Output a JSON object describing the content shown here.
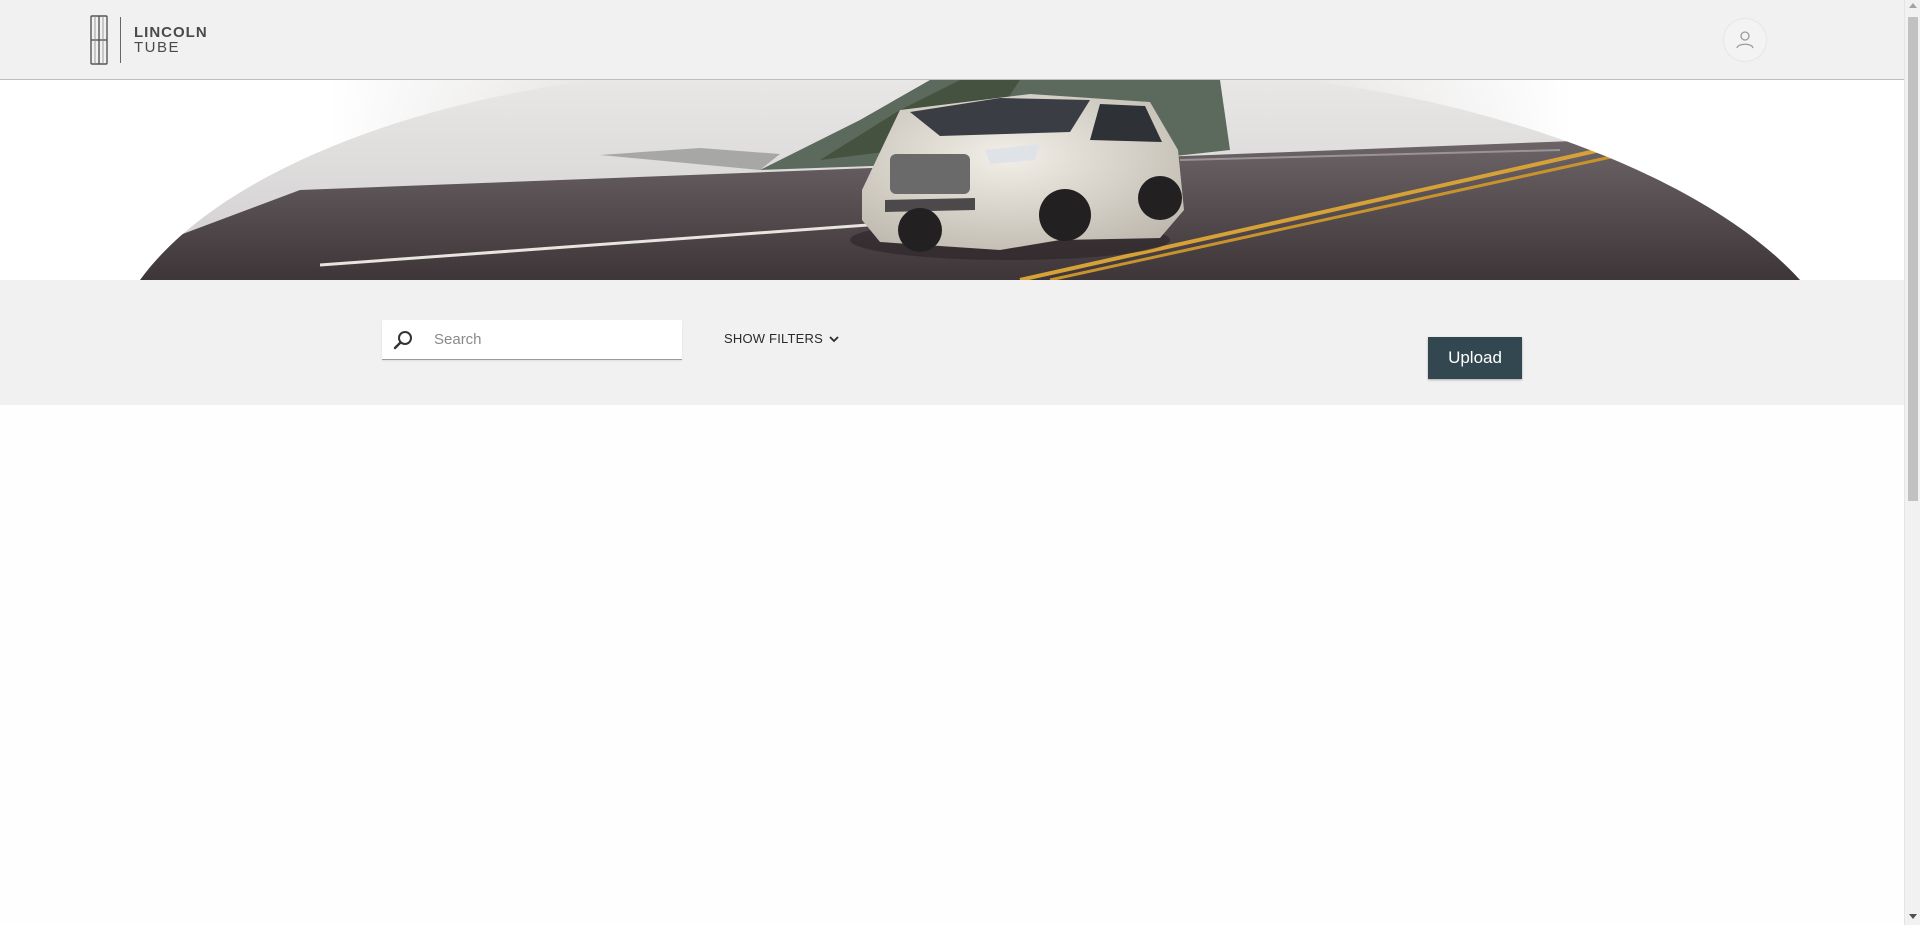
{
  "brand": {
    "line1": "LINCOLN",
    "line2": "TUBE"
  },
  "header": {
    "user_icon": "user-icon"
  },
  "hero": {
    "image": "suv-on-coastal-road"
  },
  "toolbar": {
    "search_placeholder": "Search",
    "search_value": "",
    "filters_label": "SHOW FILTERS",
    "upload_label": "Upload"
  },
  "colors": {
    "header_bg": "#f1f1f1",
    "upload_bg": "#334751",
    "text_dark": "#2b2b2b"
  }
}
